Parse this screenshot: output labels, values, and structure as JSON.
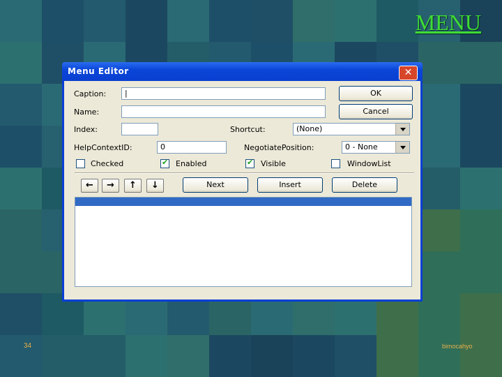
{
  "slide": {
    "title": "MENU",
    "number": "34",
    "author": "bimocahyo"
  },
  "dialog": {
    "title": "Menu Editor",
    "caption": {
      "label": "Caption:",
      "value": "|"
    },
    "name": {
      "label": "Name:",
      "value": ""
    },
    "index": {
      "label": "Index:",
      "value": ""
    },
    "shortcut": {
      "label": "Shortcut:",
      "value": "(None)"
    },
    "help_context": {
      "label": "HelpContextID:",
      "value": "0"
    },
    "negotiate": {
      "label": "NegotiatePosition:",
      "value": "0 - None"
    },
    "checked": {
      "label": "Checked",
      "value": false
    },
    "enabled": {
      "label": "Enabled",
      "value": true
    },
    "visible": {
      "label": "Visible",
      "value": true
    },
    "window_list": {
      "label": "WindowList",
      "value": false
    },
    "buttons": {
      "ok": "OK",
      "cancel": "Cancel",
      "next": "Next",
      "insert": "Insert",
      "delete": "Delete"
    },
    "arrows": {
      "left": "←",
      "right": "→",
      "up": "↑",
      "down": "↓"
    },
    "close": "✕"
  },
  "colors": {
    "title_green": "#3fdc34",
    "footer_orange": "#e9b04a",
    "titlebar_blue": "#0a46d8",
    "selection_blue": "#316ac5"
  }
}
